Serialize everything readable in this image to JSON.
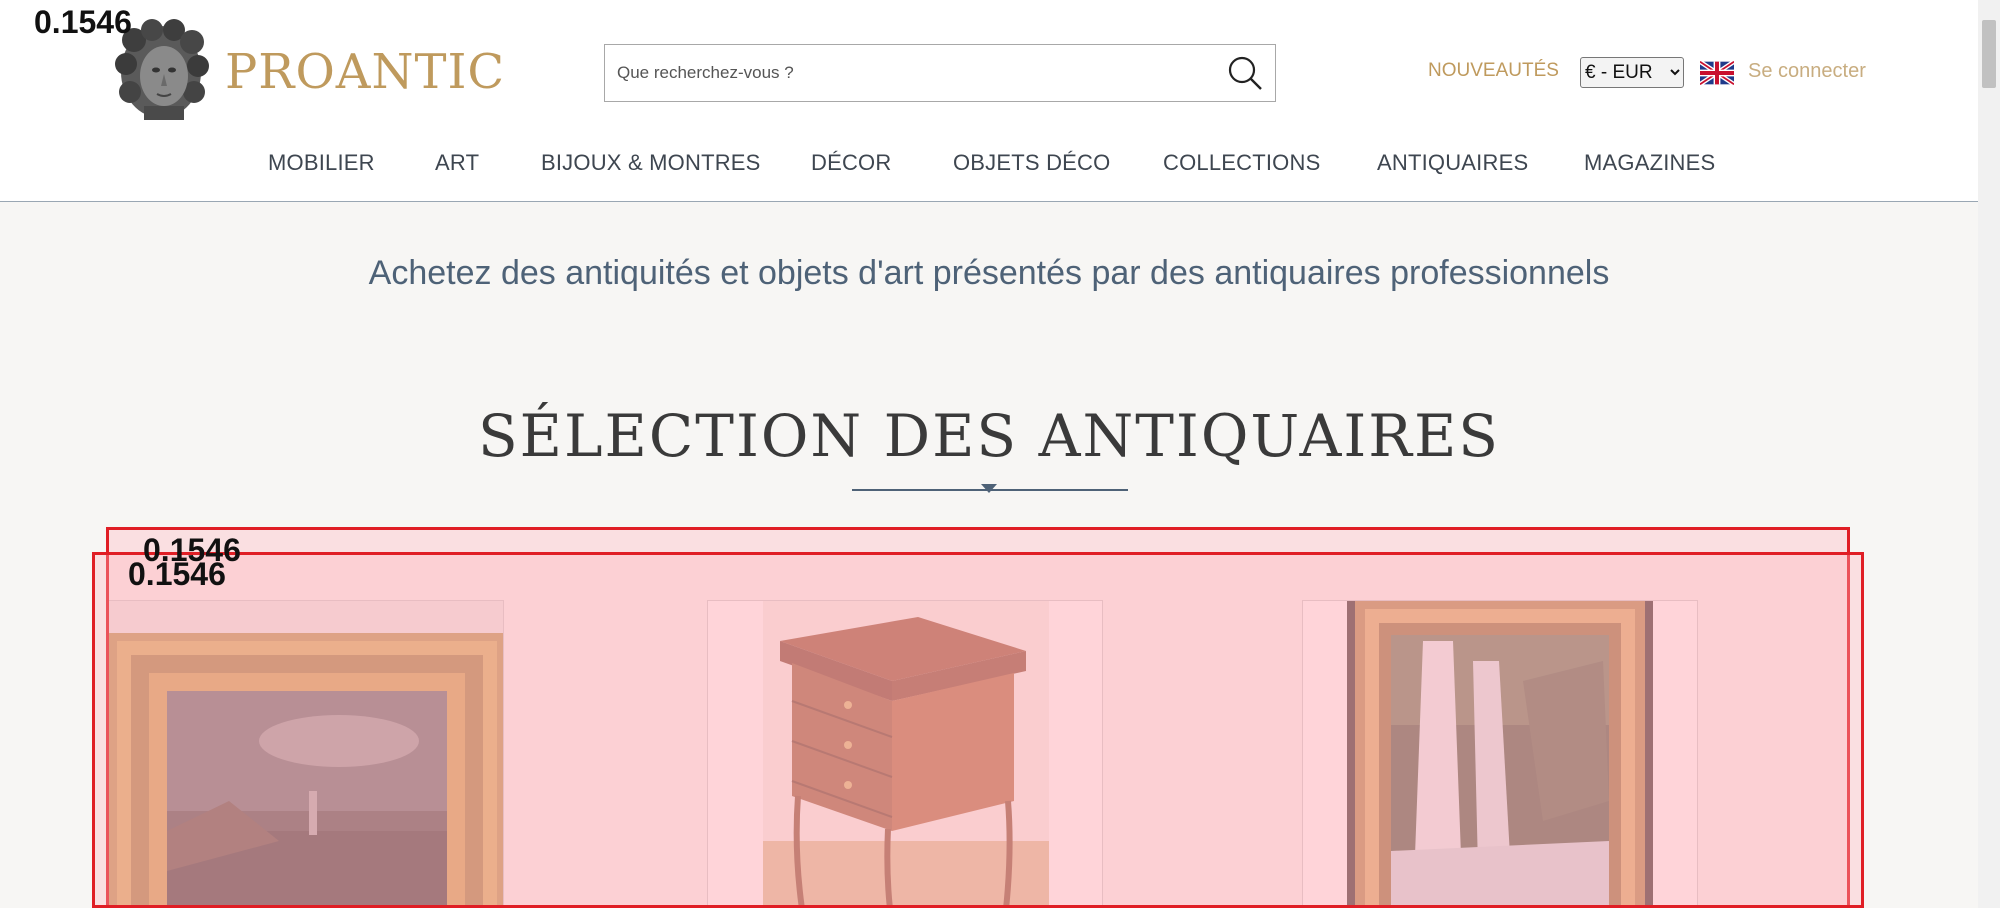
{
  "brand": {
    "name": "PROANTIC"
  },
  "search": {
    "placeholder": "Que recherchez-vous ?"
  },
  "header_links": {
    "new_items": "NOUVEAUTÉS",
    "currency": "€ - EUR",
    "login": "Se connecter"
  },
  "nav": {
    "items": [
      {
        "label": "MOBILIER"
      },
      {
        "label": "ART"
      },
      {
        "label": "BIJOUX & MONTRES"
      },
      {
        "label": "DÉCOR"
      },
      {
        "label": "OBJETS DÉCO"
      },
      {
        "label": "COLLECTIONS"
      },
      {
        "label": "ANTIQUAIRES"
      },
      {
        "label": "MAGAZINES"
      }
    ]
  },
  "tagline": "Achetez des antiquités et objets d'art présentés par des antiquaires professionnels",
  "section": {
    "title": "SÉLECTION DES ANTIQUAIRES"
  },
  "overlay_labels": {
    "page": "0.1546",
    "box_1": "0.1546",
    "box_2": "0.1546"
  },
  "icons": {
    "search": "search-icon",
    "flag": "uk-flag-icon"
  },
  "colors": {
    "gold": "#bf9a5d",
    "slate": "#4e6277",
    "overlay_red": "#e01e25"
  }
}
